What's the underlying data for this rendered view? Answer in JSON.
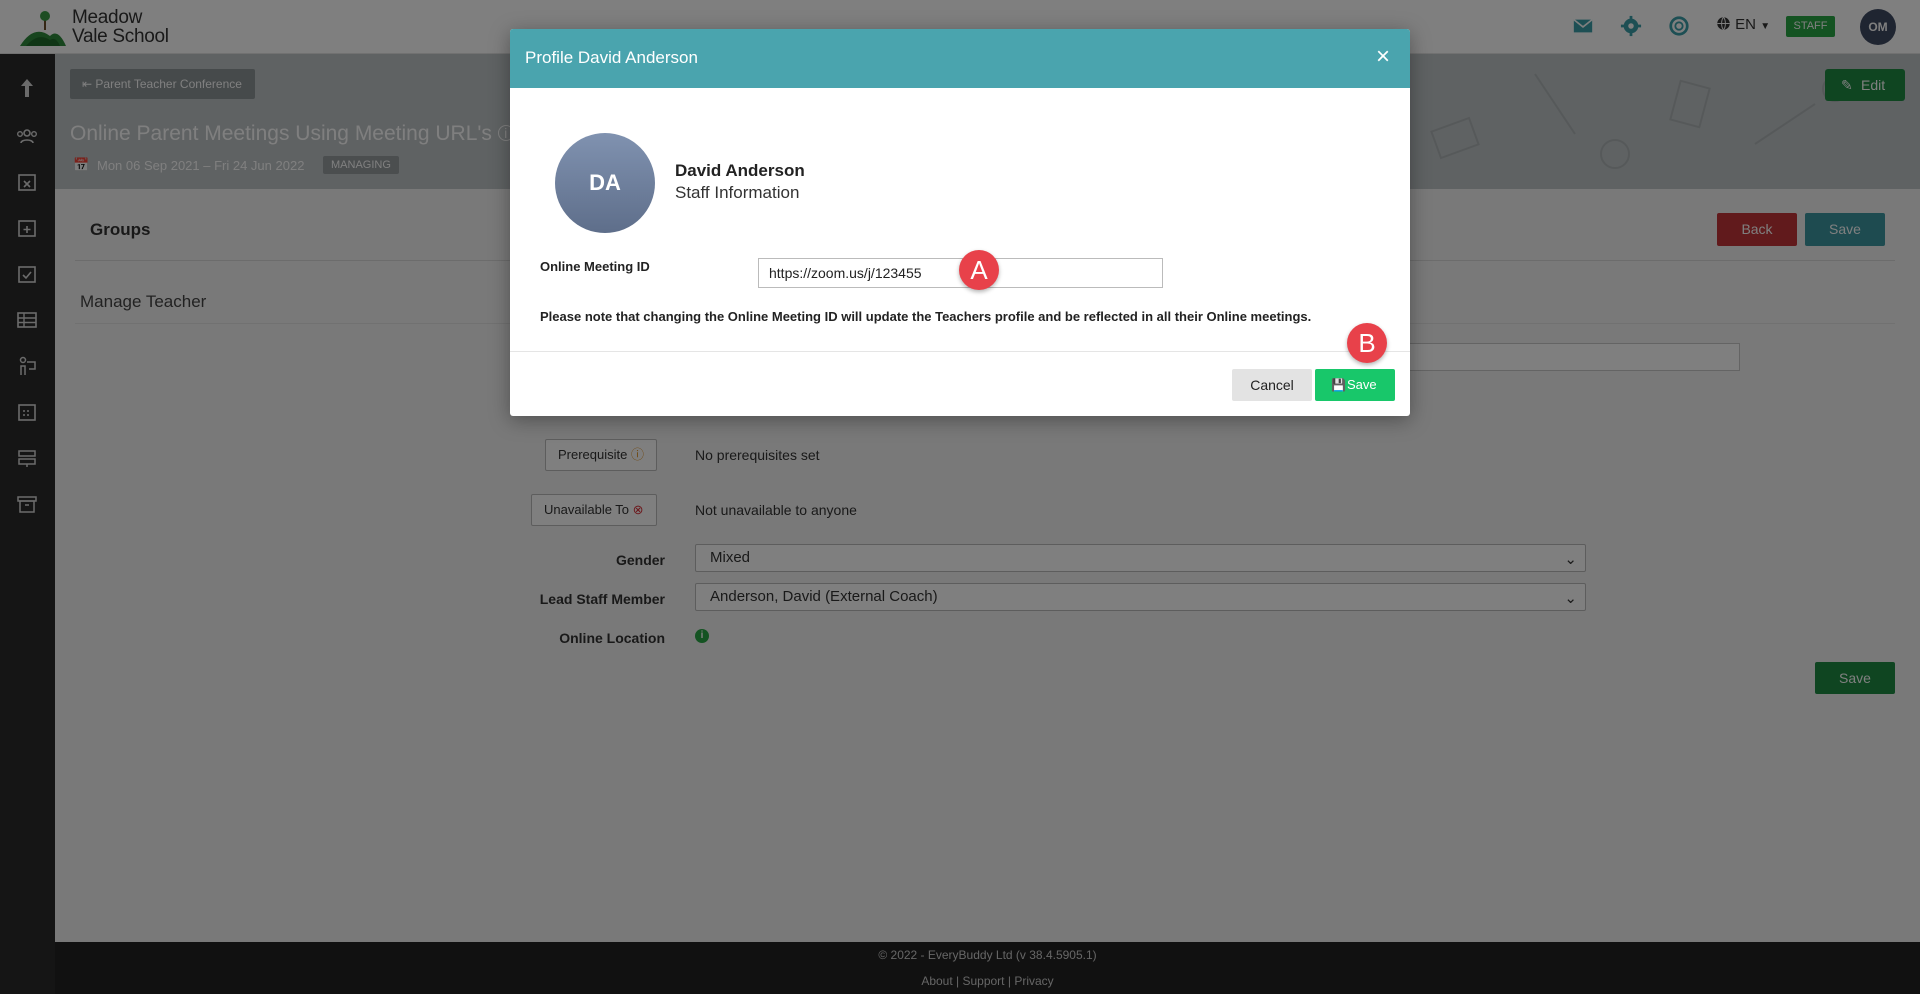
{
  "app": {
    "school_name_line1": "Meadow",
    "school_name_line2": "Vale School",
    "language": "EN",
    "role_badge": "STAFF",
    "user_initials": "OM"
  },
  "banner": {
    "back_label": "Parent Teacher Conference",
    "title": "Online Parent Meetings Using Meeting URL's",
    "date_range": "Mon 06 Sep 2021 – Fri 24 Jun 2022",
    "status": "MANAGING",
    "edit_label": "Edit"
  },
  "content": {
    "groups_title": "Groups",
    "back_button": "Back",
    "save_button": "Save",
    "manage_title": "Manage Teacher",
    "prerequisite_label": "Prerequisite",
    "prerequisite_value": "No prerequisites set",
    "unavailable_label": "Unavailable To",
    "unavailable_value": "Not unavailable to anyone",
    "gender_label": "Gender",
    "gender_value": "Mixed",
    "lead_staff_label": "Lead Staff Member",
    "lead_staff_value": "Anderson, David (External Coach)",
    "online_location_label": "Online Location",
    "bottom_save": "Save"
  },
  "footer": {
    "copyright": "© 2022 - EveryBuddy Ltd (v 38.4.5905.1)",
    "about": "About",
    "support": "Support",
    "privacy": "Privacy",
    "separator": "|"
  },
  "modal": {
    "title": "Profile David Anderson",
    "close_symbol": "×",
    "avatar_initials": "DA",
    "name": "David Anderson",
    "role": "Staff Information",
    "meeting_id_label": "Online Meeting ID",
    "meeting_id_value": "https://zoom.us/j/123455",
    "note": "Please note that changing the Online Meeting ID will update the Teachers profile and be reflected in all their Online meetings.",
    "cancel_label": "Cancel",
    "save_label": "Save"
  },
  "markers": {
    "a": "A",
    "b": "B"
  },
  "colors": {
    "header_teal": "#4aa4ae",
    "save_green": "#18c76a",
    "back_red": "#c33438",
    "marker_red": "#e8414a"
  }
}
